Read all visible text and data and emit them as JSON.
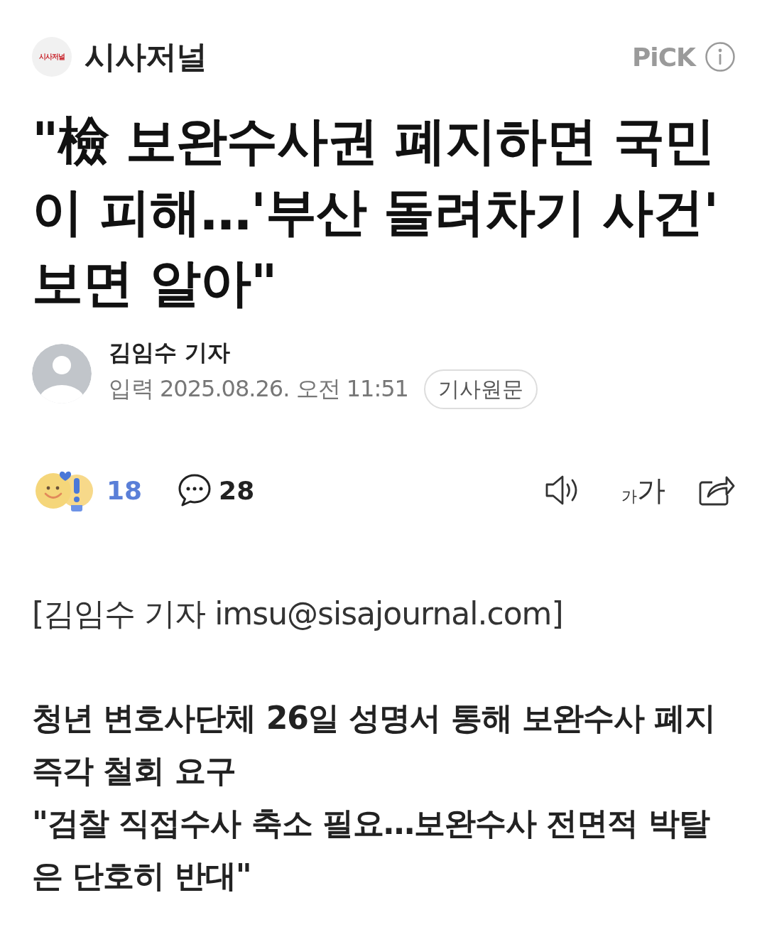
{
  "header": {
    "logo_text": "시사저널",
    "press_name": "시사저널",
    "pick_label": "PiCK"
  },
  "headline": "\"檢 보완수사권 폐지하면 국민이 피해…'부산 돌려차기 사건' 보면 알아\"",
  "byline": {
    "reporter": "김임수 기자",
    "date_label": "입력",
    "date": "2025.08.26. 오전 11:51",
    "original_button": "기사원문"
  },
  "actions": {
    "reaction_count": "18",
    "comment_count": "28",
    "font_size_small": "가",
    "font_size_large": "가"
  },
  "body": {
    "credit": "[김임수 기자 imsu@sisajournal.com]",
    "subtitles": [
      "청년 변호사단체 26일 성명서 통해 보완수사 폐지 즉각 철회 요구",
      "\"검찰 직접수사 축소 필요…보완수사 전면적 박탈은 단호히 반대\""
    ]
  }
}
